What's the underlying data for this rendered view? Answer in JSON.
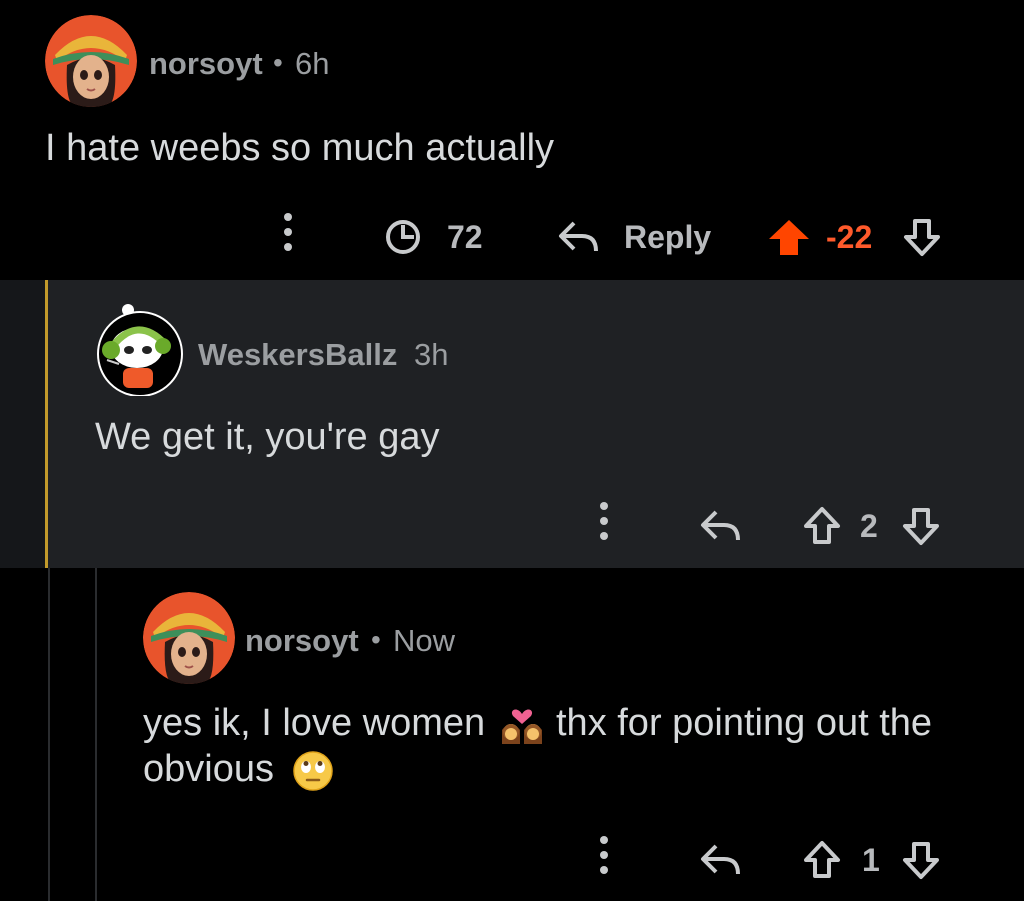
{
  "comments": [
    {
      "username": "norsoyt",
      "separator": "•",
      "time": "6h",
      "body": "I hate weebs so much actually",
      "awards": "72",
      "reply_label": "Reply",
      "score": "-22",
      "upvoted": true
    },
    {
      "username": "WeskersBallz",
      "time": "3h",
      "body": "We get it, you're gay",
      "score": "2"
    },
    {
      "username": "norsoyt",
      "separator": "•",
      "time": "Now",
      "body_line1a": "yes ik, I love women",
      "body_line1b": "thx for pointing out the",
      "body_line2": "obvious",
      "score": "1"
    }
  ],
  "colors": {
    "background": "#000000",
    "reply_background": "#1f2124",
    "thread_accent": "#c29a2b",
    "upvote": "#ff4500",
    "text": "#d7dadc",
    "muted": "#9b9ea1"
  }
}
